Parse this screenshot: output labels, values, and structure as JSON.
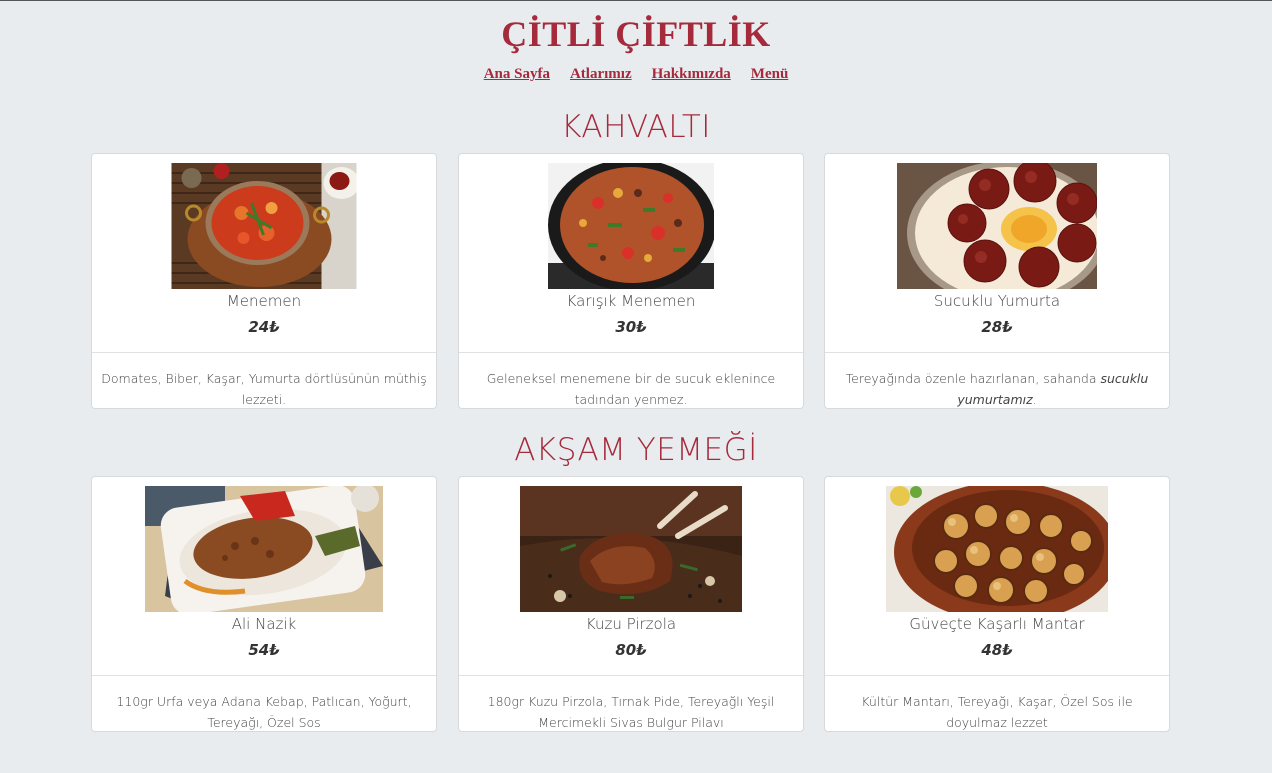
{
  "site": {
    "title": "ÇİTLİ ÇİFTLİK"
  },
  "nav": {
    "items": [
      "Ana Sayfa",
      "Atlarımız",
      "Hakkımızda",
      "Menü"
    ]
  },
  "sections": [
    {
      "heading": "KAHVALTI",
      "items": [
        {
          "name": "Menemen",
          "price": "24₺",
          "desc": "Domates, Biber, Kaşar, Yumurta dörtlüsünün müthiş lezzeti.",
          "image": "menemen-photo"
        },
        {
          "name": "Karışık Menemen",
          "price": "30₺",
          "desc": "Geleneksel menemene bir de sucuk eklenince tadından yenmez.",
          "image": "karisik-menemen-photo"
        },
        {
          "name": "Sucuklu Yumurta",
          "price": "28₺",
          "desc_plain": "Tereyağında özenle hazırlanan, sahanda ",
          "desc_italic": "sucuklu yumurtamız",
          "desc_tail": ".",
          "image": "sucuklu-yumurta-photo"
        }
      ]
    },
    {
      "heading": "AKŞAM YEMEĞİ",
      "items": [
        {
          "name": "Ali Nazik",
          "price": "54₺",
          "desc": "110gr Urfa veya Adana Kebap, Patlıcan, Yoğurt, Tereyağı, Özel Sos",
          "image": "ali-nazik-photo"
        },
        {
          "name": "Kuzu Pirzola",
          "price": "80₺",
          "desc": "180gr Kuzu Pirzola, Tırnak Pide, Tereyağlı Yeşil Mercimekli Sivas Bulgur Pilavı",
          "image": "kuzu-pirzola-photo"
        },
        {
          "name": "Güveçte Kaşarlı Mantar",
          "price": "48₺",
          "desc": "Kültür Mantarı, Tereyağı, Kaşar, Özel Sos ile doyulmaz lezzet",
          "image": "guvecte-mantar-photo"
        }
      ]
    }
  ],
  "colors": {
    "brand": "#a52a3c",
    "background": "#e9ecef",
    "card": "#ffffff"
  }
}
